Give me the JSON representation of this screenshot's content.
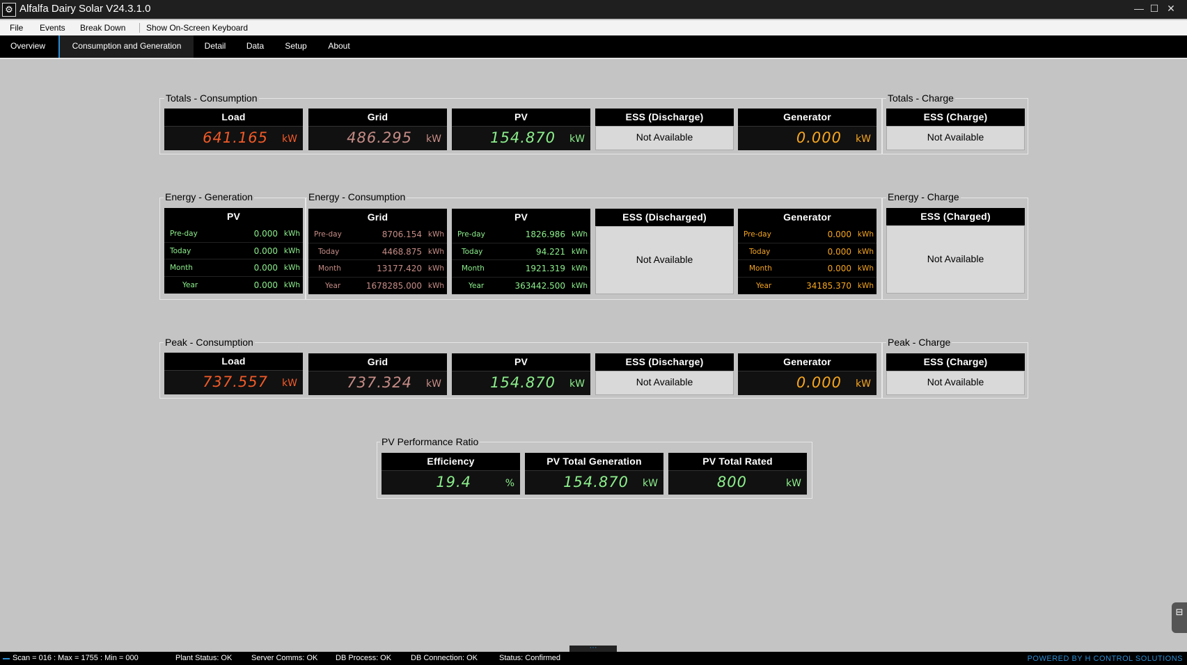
{
  "app": {
    "title": "Alfalfa Dairy Solar V24.3.1.0"
  },
  "menu": [
    "File",
    "Events",
    "Break Down",
    "Show On-Screen Keyboard"
  ],
  "tabs": [
    "Overview",
    "Consumption and Generation",
    "Detail",
    "Data",
    "Setup",
    "About"
  ],
  "active_tab": "Consumption and Generation",
  "totals": {
    "consumption_title": "Totals - Consumption",
    "charge_title": "Totals - Charge",
    "load": {
      "label": "Load",
      "value": "641.165",
      "unit": "kW"
    },
    "grid": {
      "label": "Grid",
      "value": "486.295",
      "unit": "kW"
    },
    "pv": {
      "label": "PV",
      "value": "154.870",
      "unit": "kW"
    },
    "ess_discharge": {
      "label": "ESS (Discharge)",
      "value": "Not Available"
    },
    "generator": {
      "label": "Generator",
      "value": "0.000",
      "unit": "kW"
    },
    "ess_charge": {
      "label": "ESS (Charge)",
      "value": "Not Available"
    }
  },
  "energy": {
    "generation_title": "Energy - Generation",
    "consumption_title": "Energy - Consumption",
    "charge_title": "Energy - Charge",
    "row_labels": [
      "Pre-day",
      "Today",
      "Month",
      "Year"
    ],
    "unit": "kWh",
    "pv_gen": {
      "label": "PV",
      "values": [
        "0.000",
        "0.000",
        "0.000",
        "0.000"
      ]
    },
    "grid": {
      "label": "Grid",
      "values": [
        "8706.154",
        "4468.875",
        "13177.420",
        "1678285.000"
      ]
    },
    "pv": {
      "label": "PV",
      "values": [
        "1826.986",
        "94.221",
        "1921.319",
        "363442.500"
      ]
    },
    "ess_discharged": {
      "label": "ESS (Discharged)",
      "value": "Not Available"
    },
    "generator": {
      "label": "Generator",
      "values": [
        "0.000",
        "0.000",
        "0.000",
        "34185.370"
      ]
    },
    "ess_charged": {
      "label": "ESS (Charged)",
      "value": "Not Available"
    }
  },
  "peak": {
    "consumption_title": "Peak - Consumption",
    "charge_title": "Peak - Charge",
    "load": {
      "label": "Load",
      "value": "737.557",
      "unit": "kW"
    },
    "grid": {
      "label": "Grid",
      "value": "737.324",
      "unit": "kW"
    },
    "pv": {
      "label": "PV",
      "value": "154.870",
      "unit": "kW"
    },
    "ess_discharge": {
      "label": "ESS (Discharge)",
      "value": "Not Available"
    },
    "generator": {
      "label": "Generator",
      "value": "0.000",
      "unit": "kW"
    },
    "ess_charge": {
      "label": "ESS (Charge)",
      "value": "Not Available"
    }
  },
  "performance": {
    "title": "PV Performance Ratio",
    "efficiency": {
      "label": "Efficiency",
      "value": "19.4",
      "unit": "%"
    },
    "pv_total_generation": {
      "label": "PV Total Generation",
      "value": "154.870",
      "unit": "kW"
    },
    "pv_total_rated": {
      "label": "PV Total Rated",
      "value": "800",
      "unit": "kW"
    }
  },
  "status": {
    "scan": "Scan = 016 : Max = 1755 : Min = 000",
    "plant": "Plant Status: OK",
    "server": "Server Comms: OK",
    "db_process": "DB Process:  OK",
    "db_connection": "DB Connection:  OK",
    "status": "Status:  Confirmed",
    "powered_by": "POWERED BY H CONTROL SOLUTIONS"
  },
  "colors": {
    "load": "#f25a28",
    "grid": "#c68c86",
    "pv": "#8cef8c",
    "generator": "#f6a51e",
    "accent": "#2a8dd4"
  }
}
